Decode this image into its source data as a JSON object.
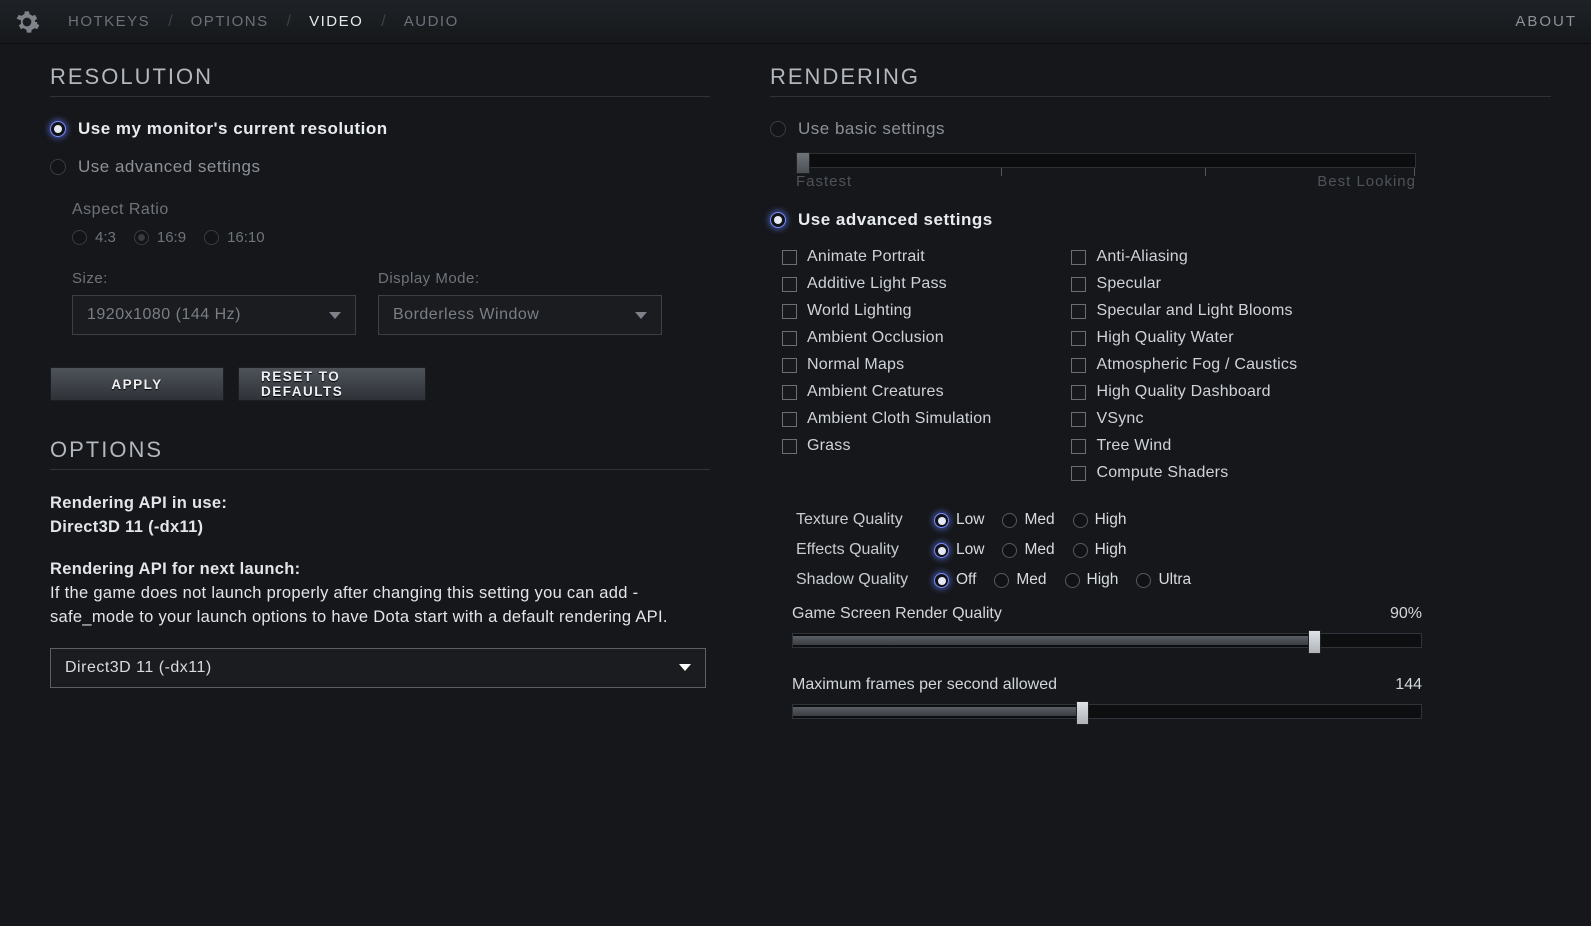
{
  "nav": {
    "tabs": [
      "HOTKEYS",
      "OPTIONS",
      "VIDEO",
      "AUDIO"
    ],
    "active": "VIDEO",
    "about": "ABOUT"
  },
  "resolution": {
    "heading": "RESOLUTION",
    "use_monitor": "Use my monitor's current resolution",
    "use_advanced": "Use advanced settings",
    "aspect_title": "Aspect Ratio",
    "aspects": [
      "4:3",
      "16:9",
      "16:10"
    ],
    "size_label": "Size:",
    "size_value": "1920x1080 (144 Hz)",
    "mode_label": "Display Mode:",
    "mode_value": "Borderless Window",
    "apply": "APPLY",
    "reset": "RESET TO DEFAULTS"
  },
  "options": {
    "heading": "OPTIONS",
    "api_in_use_label": "Rendering API in use:",
    "api_in_use_value": "Direct3D 11 (-dx11)",
    "api_next_label": "Rendering API for next launch:",
    "api_next_text": "If the game does not launch properly after changing this setting you can add -safe_mode to your launch options to have Dota start with a default rendering API.",
    "api_dropdown": "Direct3D 11 (-dx11)"
  },
  "rendering": {
    "heading": "RENDERING",
    "use_basic": "Use basic settings",
    "basic_left": "Fastest",
    "basic_right": "Best Looking",
    "use_advanced": "Use advanced settings",
    "checks_left": [
      "Animate Portrait",
      "Additive Light Pass",
      "World Lighting",
      "Ambient Occlusion",
      "Normal Maps",
      "Ambient Creatures",
      "Ambient Cloth Simulation",
      "Grass"
    ],
    "checks_right": [
      "Anti-Aliasing",
      "Specular",
      "Specular and Light Blooms",
      "High Quality Water",
      "Atmospheric Fog / Caustics",
      "High Quality Dashboard",
      "VSync",
      "Tree Wind",
      "Compute Shaders"
    ],
    "texture_label": "Texture Quality",
    "texture_opts": [
      "Low",
      "Med",
      "High"
    ],
    "effects_label": "Effects Quality",
    "effects_opts": [
      "Low",
      "Med",
      "High"
    ],
    "shadow_label": "Shadow Quality",
    "shadow_opts": [
      "Off",
      "Med",
      "High",
      "Ultra"
    ],
    "render_q_label": "Game Screen Render Quality",
    "render_q_value": "90%",
    "render_q_pct": 83,
    "fps_label": "Maximum frames per second allowed",
    "fps_value": "144",
    "fps_pct": 46
  }
}
